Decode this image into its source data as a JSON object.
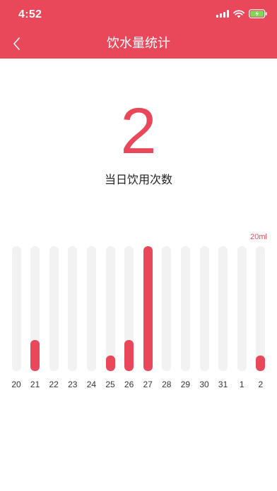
{
  "status_bar": {
    "time": "4:52"
  },
  "nav": {
    "title": "饮水量统计"
  },
  "summary": {
    "count": "2",
    "label": "当日饮用次数"
  },
  "colors": {
    "accent": "#E8485A",
    "track": "#F2F2F2"
  },
  "chart_data": {
    "type": "bar",
    "categories": [
      "20",
      "21",
      "22",
      "23",
      "24",
      "25",
      "26",
      "27",
      "28",
      "29",
      "30",
      "31",
      "1",
      "2"
    ],
    "values": [
      0,
      5,
      0,
      0,
      0,
      2.5,
      5,
      20,
      0,
      0,
      0,
      0,
      0,
      2.5
    ],
    "max_label": "20ml",
    "ylim": [
      0,
      20
    ],
    "title": "",
    "xlabel": "",
    "ylabel": ""
  }
}
